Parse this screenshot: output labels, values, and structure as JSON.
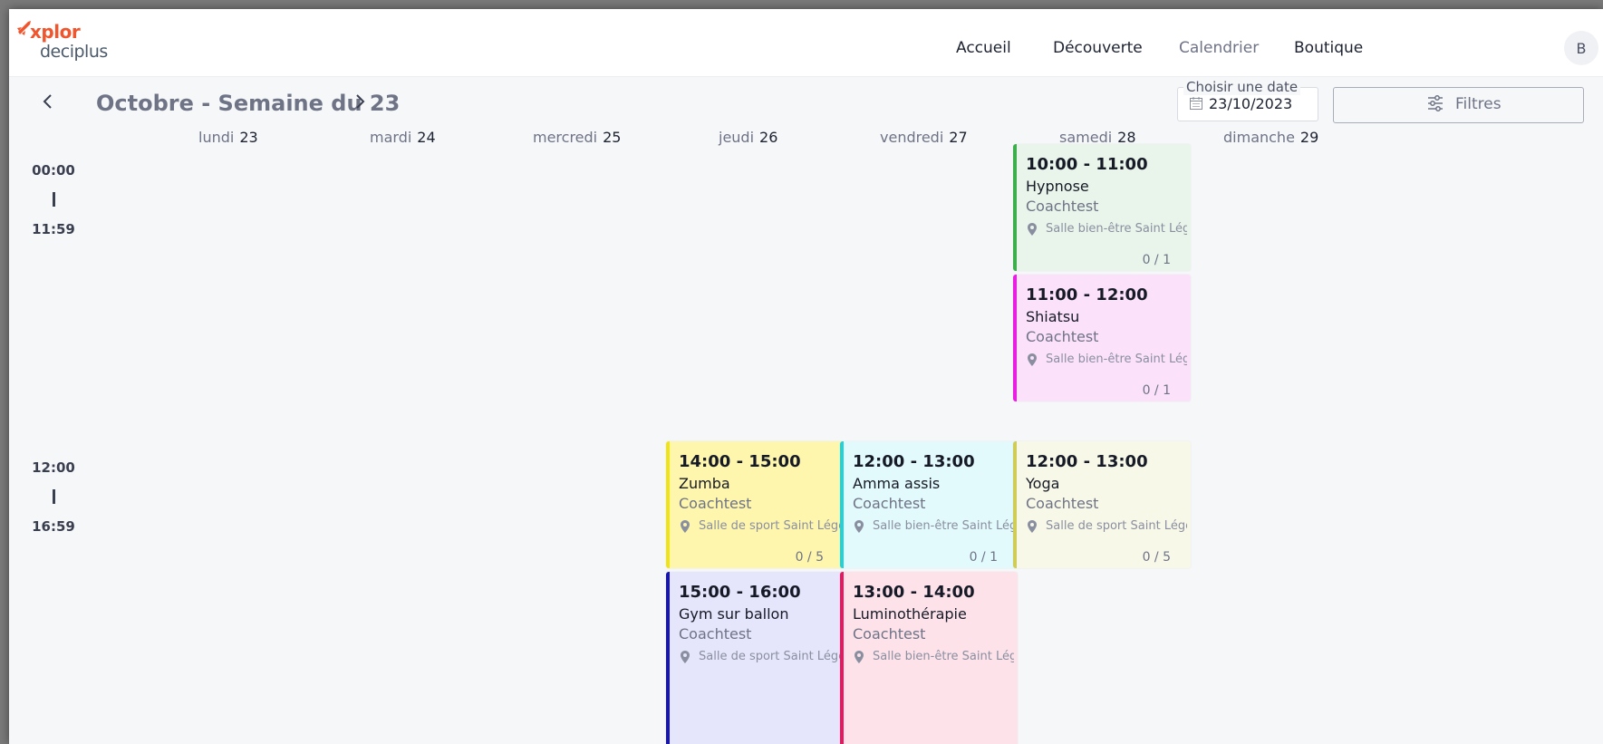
{
  "brand": {
    "top": "xplor",
    "bottom": "deciplus",
    "color": "#f0562d"
  },
  "nav": {
    "home": "Accueil",
    "discover": "Découverte",
    "calendar": "Calendrier",
    "shop": "Boutique",
    "avatar_initial": "B"
  },
  "toolbar": {
    "prev_icon": "chevron-left-icon",
    "next_icon": "chevron-right-icon",
    "week_title": "Octobre - Semaine du 23",
    "date_label": "Choisir une date",
    "date_value": "23/10/2023",
    "filter_label": "Filtres"
  },
  "days": [
    {
      "name": "lundi",
      "num": "23"
    },
    {
      "name": "mardi",
      "num": "24"
    },
    {
      "name": "mercredi",
      "num": "25"
    },
    {
      "name": "jeudi",
      "num": "26"
    },
    {
      "name": "vendredi",
      "num": "27"
    },
    {
      "name": "samedi",
      "num": "28"
    },
    {
      "name": "dimanche",
      "num": "29"
    }
  ],
  "bands": [
    {
      "start": "00:00",
      "sep": "|",
      "end": "11:59"
    },
    {
      "start": "12:00",
      "sep": "|",
      "end": "16:59"
    }
  ],
  "events": [
    {
      "day": "samedi",
      "time": "10:00 - 11:00",
      "name": "Hypnose",
      "coach": "Coachtest",
      "room": "Salle bien-être Saint Léger",
      "count": "0 / 1",
      "accent": "#3cae4b",
      "bg": "#e9f4ea"
    },
    {
      "day": "samedi",
      "time": "11:00 - 12:00",
      "name": "Shiatsu",
      "coach": "Coachtest",
      "room": "Salle bien-être Saint Léger",
      "count": "0 / 1",
      "accent": "#e91ee3",
      "bg": "#fce1fb"
    },
    {
      "day": "jeudi",
      "time": "14:00 - 15:00",
      "name": "Zumba",
      "coach": "Coachtest",
      "room": "Salle de sport Saint Léger",
      "count": "0 / 5",
      "accent": "#f1e416",
      "bg": "#fff6ad"
    },
    {
      "day": "vendredi",
      "time": "12:00 - 13:00",
      "name": "Amma assis",
      "coach": "Coachtest",
      "room": "Salle bien-être Saint Léger",
      "count": "0 / 1",
      "accent": "#1fd3d9",
      "bg": "#e2fafb"
    },
    {
      "day": "samedi",
      "time": "12:00 - 13:00",
      "name": "Yoga",
      "coach": "Coachtest",
      "room": "Salle de sport Saint Léger",
      "count": "0 / 5",
      "accent": "#cfcc58",
      "bg": "#f8f8e9"
    },
    {
      "day": "jeudi",
      "time": "15:00 - 16:00",
      "name": "Gym sur ballon",
      "coach": "Coachtest",
      "room": "Salle de sport Saint Léger",
      "count": "",
      "accent": "#1414b8",
      "bg": "#e5e5fb"
    },
    {
      "day": "vendredi",
      "time": "13:00 - 14:00",
      "name": "Luminothérapie",
      "coach": "Coachtest",
      "room": "Salle bien-être Saint Léger",
      "count": "",
      "accent": "#e9175f",
      "bg": "#fde2ea"
    }
  ],
  "icons": {
    "location": "map-pin-icon",
    "calendar": "calendar-icon",
    "filter": "sliders-icon"
  }
}
